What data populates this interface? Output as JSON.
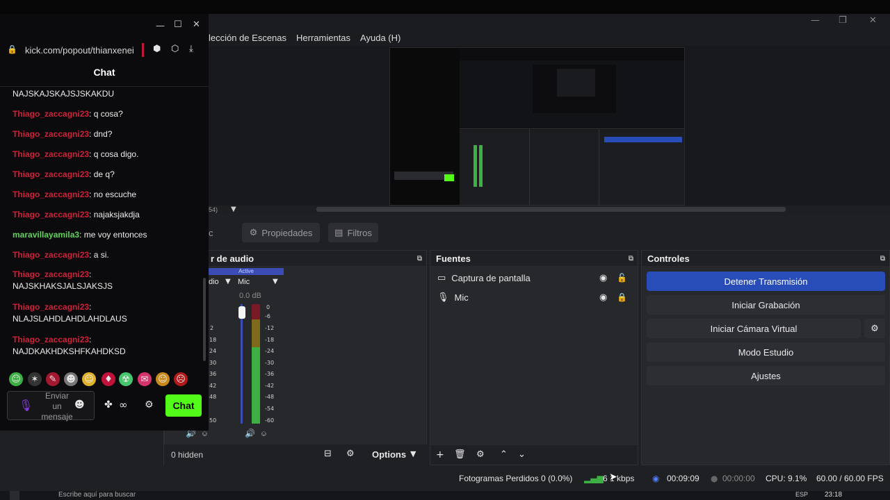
{
  "obs": {
    "menu": [
      "lección de Escenas",
      "Herramientas",
      "Ayuda (H)"
    ],
    "win_controls": {
      "minimize": "—",
      "maximize": "❐",
      "close": "✕"
    },
    "scene_info": "54)",
    "props_bar": {
      "clipped_label": "c",
      "properties": "Propiedades",
      "filters": "Filtros"
    },
    "mixer": {
      "title": "r de audio",
      "active_label": "Active",
      "channel1_label": "dio",
      "channel2_label": "Mic",
      "db": "0.0 dB",
      "ticks": [
        "0",
        "-6",
        "-12",
        "-18",
        "-24",
        "-30",
        "-36",
        "-42",
        "-48",
        "-54",
        "-60"
      ],
      "left_ticks": [
        "2",
        "18",
        "24",
        "30",
        "36",
        "42",
        "48",
        "50"
      ]
    },
    "sources": {
      "title": "Fuentes",
      "items": [
        {
          "label": "Captura de pantalla",
          "icon": "monitor-icon",
          "locked": false
        },
        {
          "label": "Mic",
          "icon": "microphone-icon",
          "locked": true
        }
      ]
    },
    "controls": {
      "title": "Controles",
      "buttons": [
        "Detener Transmisión",
        "Iniciar Grabación",
        "Iniciar Cámara Virtual",
        "Modo Estudio",
        "Ajustes"
      ]
    },
    "bottom": {
      "hidden": "0 hidden",
      "options": "Options"
    },
    "status": {
      "dropped": "Fotogramas Perdidos 0 (0.0%)",
      "bitrate": "6 1 kbps",
      "stream_time": "00:09:09",
      "rec_time": "00:00:00",
      "cpu": "CPU: 9.1%",
      "fps": "60.00 / 60.00 FPS"
    },
    "accent_color": "#284cb8"
  },
  "chat": {
    "url": "kick.com/popout/thianxenei",
    "title": "Chat",
    "messages": [
      {
        "nick": "",
        "text": "NAJSKAJSKAJSJSKAKDU"
      },
      {
        "nick": "Thiago_zaccagni23",
        "text": ": q cosa?"
      },
      {
        "nick": "Thiago_zaccagni23",
        "text": ": dnd?"
      },
      {
        "nick": "Thiago_zaccagni23",
        "text": ": q cosa digo."
      },
      {
        "nick": "Thiago_zaccagni23",
        "text": ": de q?"
      },
      {
        "nick": "Thiago_zaccagni23",
        "text": ": no escuche"
      },
      {
        "nick": "Thiago_zaccagni23",
        "text": ": najaksjakdja"
      },
      {
        "nick": "maravillayamila3",
        "text": ": me voy entonces"
      },
      {
        "nick": "Thiago_zaccagni23",
        "text": ": a si."
      },
      {
        "nick": "Thiago_zaccagni23",
        "text": ":",
        "line2": "NAJSKHAKSJALSJAKSJS"
      },
      {
        "nick": "Thiago_zaccagni23",
        "text": ":",
        "line2": "NLAJSLAHDLAHDLAHDLAUS"
      },
      {
        "nick": "Thiago_zaccagni23",
        "text": ":",
        "line2": "NAJDKAKHDKSHFKAHDKSD"
      }
    ],
    "input_placeholder": "Enviar un mensaje",
    "send_label": "Chat",
    "brand_color": "#53fc18"
  },
  "taskbar": {
    "search_placeholder": "Escribe aquí para buscar",
    "time": "23:18",
    "lang": "ESP"
  }
}
